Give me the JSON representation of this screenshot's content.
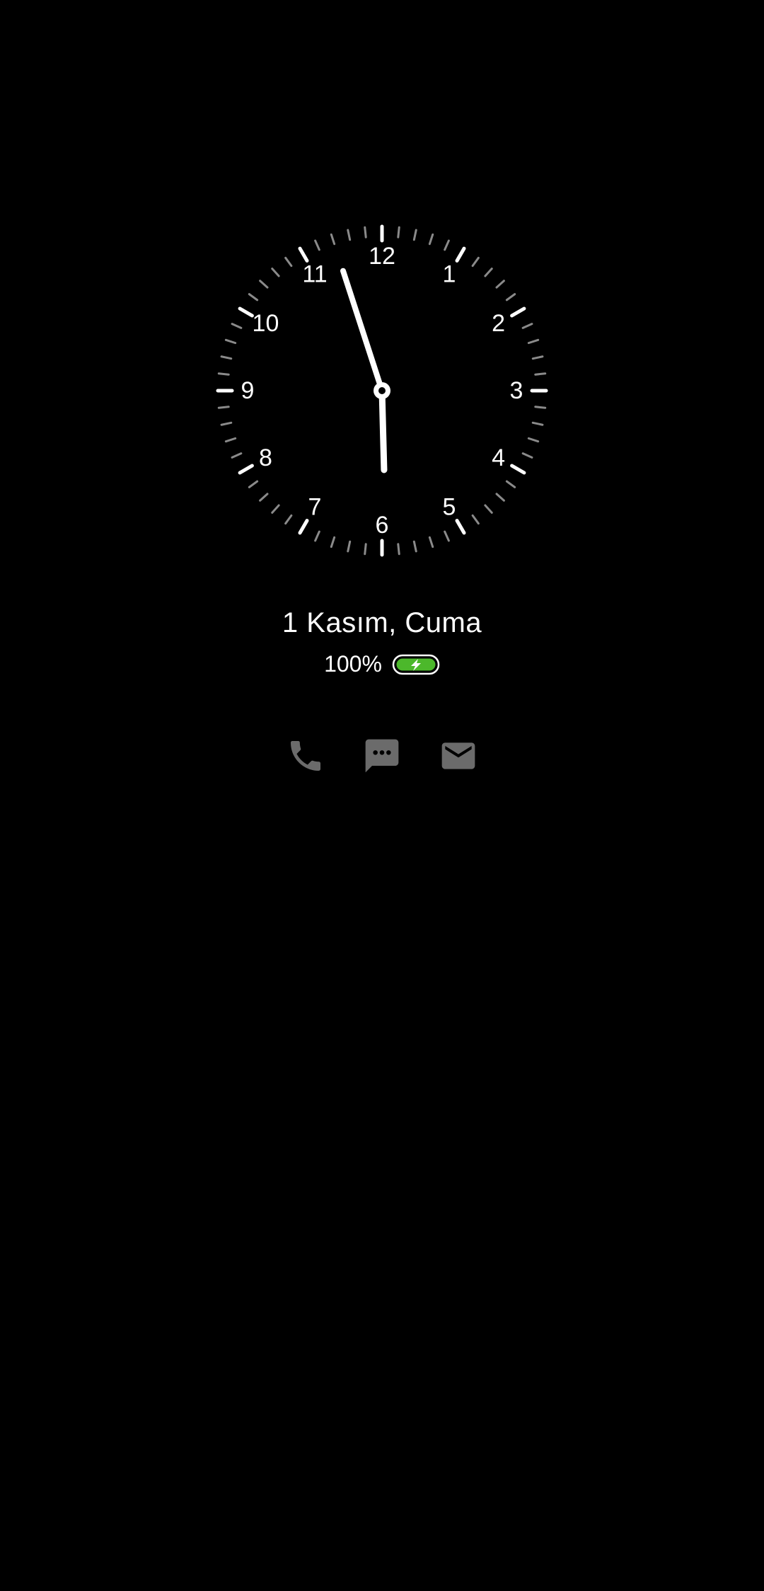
{
  "clock": {
    "hour": 5,
    "minute": 57,
    "numerals": [
      "12",
      "1",
      "2",
      "3",
      "4",
      "5",
      "6",
      "7",
      "8",
      "9",
      "10",
      "11"
    ]
  },
  "date_label": "1 Kasım, Cuma",
  "battery": {
    "percent_label": "100%",
    "level": 1.0,
    "charging": true,
    "color": "#4cb82b"
  },
  "notifications": [
    {
      "icon": "phone-icon"
    },
    {
      "icon": "message-icon"
    },
    {
      "icon": "email-icon"
    }
  ],
  "colors": {
    "background": "#000000",
    "foreground": "#ffffff",
    "minor_tick": "#8a8a8a",
    "notification_icon": "#6b6b6b"
  }
}
